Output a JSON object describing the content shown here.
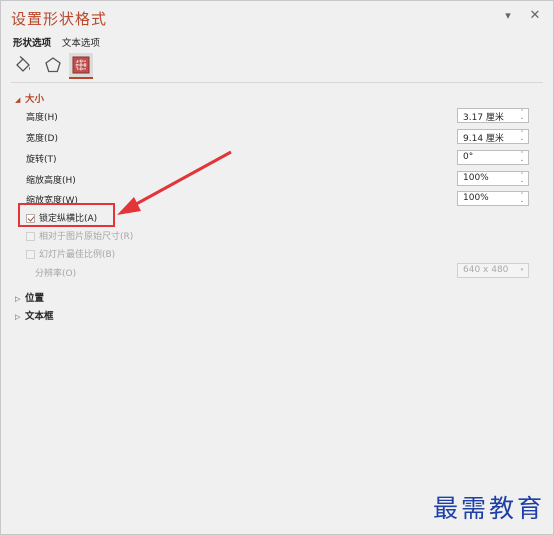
{
  "pane": {
    "title": "设置形状格式",
    "tabs": [
      {
        "label": "形状选项",
        "active": true
      },
      {
        "label": "文本选项",
        "active": false
      }
    ],
    "icons": [
      "fill-line-icon",
      "effects-pentagon-icon",
      "size-properties-icon"
    ]
  },
  "size_section": {
    "header": "大小",
    "height": {
      "label": "高度(H)",
      "value": "3.17 厘米"
    },
    "width": {
      "label": "宽度(D)",
      "value": "9.14 厘米"
    },
    "rotation": {
      "label": "旋转(T)",
      "value": "0°"
    },
    "scale_height": {
      "label": "缩放高度(H)",
      "value": "100%"
    },
    "scale_width": {
      "label": "缩放宽度(W)",
      "value": "100%"
    },
    "lock_aspect": {
      "label": "锁定纵横比(A)",
      "checked": true
    },
    "relative_to_original": {
      "label": "相对于图片原始尺寸(R)",
      "checked": false,
      "disabled": true
    },
    "best_scale_slideshow": {
      "label": "幻灯片最佳比例(B)",
      "checked": false,
      "disabled": true
    },
    "resolution": {
      "label": "分辨率(O)",
      "value": "640 x 480",
      "disabled": true
    }
  },
  "collapsed_sections": [
    "位置",
    "文本框"
  ],
  "watermark": "最需教育",
  "colors": {
    "accent": "#b7472a",
    "annotation_red": "#e3343a",
    "watermark_blue": "#1d3fa7"
  }
}
